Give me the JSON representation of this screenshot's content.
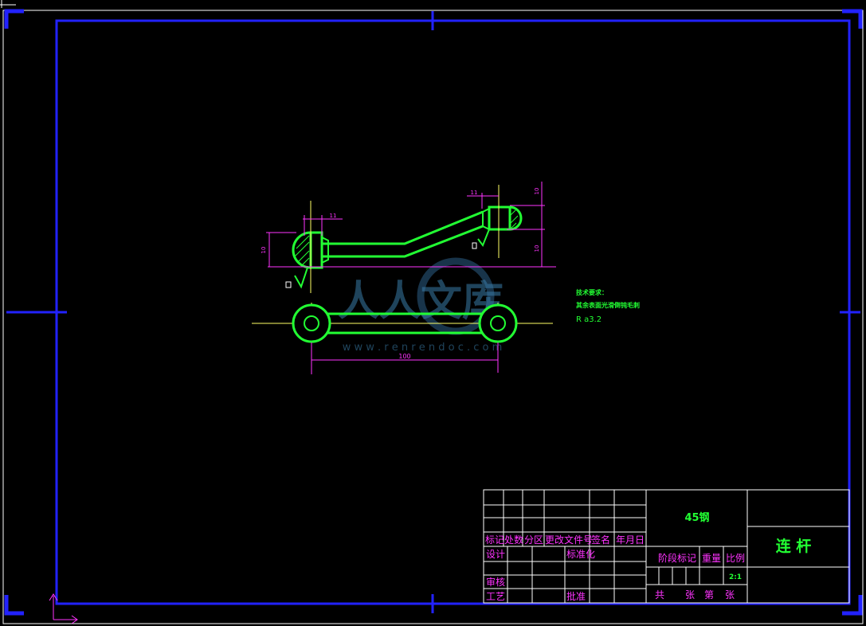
{
  "drawing": {
    "part_name": "连 杆",
    "material": "45钢",
    "scale": "2:1"
  },
  "tech_requirements": {
    "title": "技术要求：",
    "line1": "其余表面光滑倒钝毛刺",
    "roughness": "R a3.2"
  },
  "dimensions": {
    "length": "100",
    "d_top_left": "11",
    "d_top_right": "11",
    "h_left": "10",
    "h_right_top": "10",
    "h_right_bottom": "10"
  },
  "title_block": {
    "row_marks": [
      "标记",
      "处数",
      "分区",
      "更改文件号",
      "签名",
      "年月日"
    ],
    "design": "设计",
    "standardize": "标准化",
    "review": "审核",
    "process": "工艺",
    "approve": "批准",
    "stage_mark": "阶段标记",
    "weight": "重量",
    "scale_label": "比例",
    "sheets_total": "共",
    "sheets_unit1": "张",
    "sheet_no": "第",
    "sheets_unit2": "张"
  },
  "watermark": {
    "text": "人人文库",
    "url": "w w w . r e n r e n d o c . c o m"
  }
}
